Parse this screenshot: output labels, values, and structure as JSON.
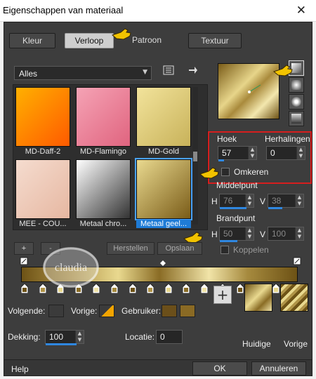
{
  "window": {
    "title": "Eigenschappen van materiaal",
    "close_glyph": "✕"
  },
  "tabs": [
    {
      "label": "Kleur",
      "active": false
    },
    {
      "label": "Verloop",
      "active": true
    },
    {
      "label": "Patroon",
      "active": false
    },
    {
      "label": "Textuur",
      "active": false
    }
  ],
  "category_dropdown": {
    "value": "Alles"
  },
  "gradients": [
    {
      "label": "MD-Daff-2",
      "selected": false,
      "colors": [
        "#ffb000",
        "#ff5a00"
      ]
    },
    {
      "label": "MD-Flamingo",
      "selected": false,
      "colors": [
        "#f5a3b5",
        "#e0647f"
      ]
    },
    {
      "label": "MD-Gold",
      "selected": false,
      "colors": [
        "#f2e39b",
        "#c8b25a"
      ]
    },
    {
      "label": "MEE - COU...",
      "selected": false,
      "colors": [
        "#f5dccf",
        "#e6b7a1"
      ]
    },
    {
      "label": "Metaal chro...",
      "selected": false,
      "colors": [
        "#ffffff",
        "#333333"
      ]
    },
    {
      "label": "Metaal geel...",
      "selected": true,
      "colors": [
        "#e9d98f",
        "#7a5c18"
      ]
    }
  ],
  "angle": {
    "label": "Hoek",
    "value": "57"
  },
  "repeats": {
    "label": "Herhalingen",
    "value": "0"
  },
  "invert": {
    "label": "Omkeren"
  },
  "center": {
    "label": "Middelpunt",
    "h_label": "H",
    "h_value": "76",
    "v_label": "V",
    "v_value": "38"
  },
  "focal": {
    "label": "Brandpunt",
    "h_label": "H",
    "h_value": "50",
    "v_label": "V",
    "v_value": "100"
  },
  "link": {
    "label": "Koppelen"
  },
  "buttons": {
    "add": "+",
    "remove": "-",
    "restore": "Herstellen",
    "save": "Opslaan"
  },
  "watermark": {
    "text": "claudia"
  },
  "stops_row": {
    "next_label": "Volgende:",
    "prev_label": "Vorige:",
    "user_label": "Gebruiker:",
    "opacity_label": "Dekking:",
    "opacity_value": "100",
    "location_label": "Locatie:",
    "location_value": "0",
    "user_color_1": "#6b4f1a",
    "user_color_2": "#8a6a24"
  },
  "previews": {
    "current": "Huidige",
    "previous": "Vorige"
  },
  "footer": {
    "help": "Help",
    "ok": "OK",
    "cancel": "Annuleren"
  }
}
